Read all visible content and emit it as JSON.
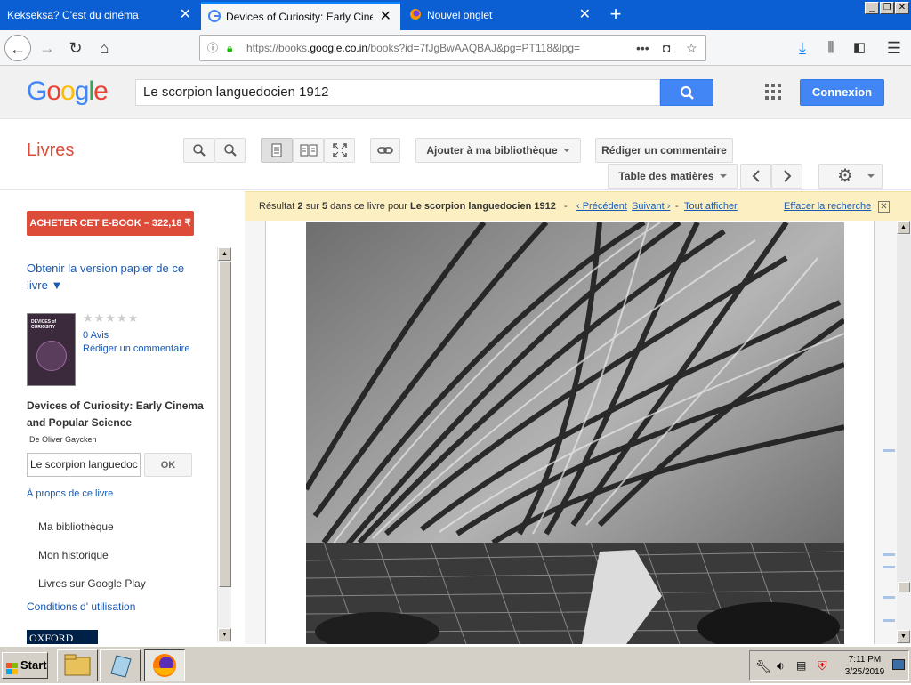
{
  "browser": {
    "tabs": [
      {
        "title": "Kekseksa? C'est du cinéma",
        "active": false
      },
      {
        "title": "Devices of Curiosity: Early Cinema",
        "active": true
      },
      {
        "title": "Nouvel onglet",
        "active": false
      }
    ],
    "url_prefix": "https://books.",
    "url_domain": "google.co.in",
    "url_path": "/books?id=7fJgBwAAQBAJ&pg=PT118&lpg="
  },
  "google": {
    "logo": "Google",
    "search_query": "Le scorpion languedocien 1912",
    "signin_label": "Connexion"
  },
  "toolbar": {
    "section_title": "Livres",
    "add_library": "Ajouter à ma bibliothèque",
    "write_review": "Rédiger un commentaire",
    "toc": "Table des matières"
  },
  "sidebar": {
    "buy_label": "ACHETER CET E-BOOK – 322,18 ₹",
    "paper_version": "Obtenir la version papier de ce livre ▼",
    "rating_stars": "★★★★★",
    "reviews_count": "0 Avis",
    "write_review": "Rédiger un commentaire",
    "book_title": "Devices of Curiosity: Early Cinema and Popular Science",
    "author": "De Oliver Gaycken",
    "search_in_book_value": "Le scorpion languedoc",
    "ok_label": "OK",
    "about_link": "À propos de ce livre",
    "my_library": "Ma bibliothèque",
    "my_history": "Mon historique",
    "play_books": "Livres sur Google Play",
    "terms": "Conditions d' utilisation",
    "publisher_logo": "OXFORD",
    "cover_title": "DEVICES of CURIOSITY"
  },
  "result_bar": {
    "prefix": "Résultat",
    "current": "2",
    "sur": "sur",
    "total": "5",
    "mid": "dans ce livre pour",
    "query": "Le scorpion languedocien 1912",
    "dash1": "-",
    "prev": "‹ Précédent",
    "next": "Suivant ›",
    "dash2": "-",
    "show_all": "Tout afficher",
    "clear": "Effacer la recherche"
  },
  "taskbar": {
    "start_label": "Start",
    "time": "7:11 PM",
    "date": "3/25/2019"
  },
  "colors": {
    "tab_bar": "#0b5fd3",
    "google_blue": "#4285f4",
    "books_red": "#dd4b39",
    "link": "#1a5ab3",
    "result_bg": "#fcf0c2"
  }
}
